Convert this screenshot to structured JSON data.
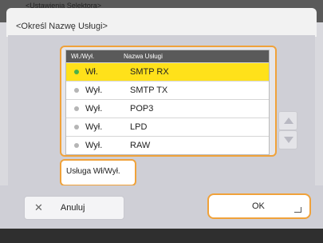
{
  "header": {
    "breadcrumb": "<Ustawienia Selektora>",
    "title": "<Określ Nazwę Usługi>"
  },
  "table": {
    "columns": [
      "Wł./Wył.",
      "Nazwa Usługi"
    ],
    "rows": [
      {
        "state": "Wł.",
        "name": "SMTP RX",
        "selected": true
      },
      {
        "state": "Wył.",
        "name": "SMTP TX",
        "selected": false
      },
      {
        "state": "Wył.",
        "name": "POP3",
        "selected": false
      },
      {
        "state": "Wył.",
        "name": "LPD",
        "selected": false
      },
      {
        "state": "Wył.",
        "name": "RAW",
        "selected": false
      }
    ]
  },
  "toggle_button": {
    "label": "Usługa Wł/Wył."
  },
  "footer": {
    "cancel_label": "Anuluj",
    "ok_label": "OK"
  },
  "icons": {
    "cancel": "close-icon",
    "scroll_up": "triangle-up-icon",
    "scroll_down": "triangle-down-icon",
    "return": "enter-icon"
  },
  "colors": {
    "highlight": "#f0a23a",
    "selected_row": "#ffe11a",
    "status_on": "#4ab04a"
  }
}
